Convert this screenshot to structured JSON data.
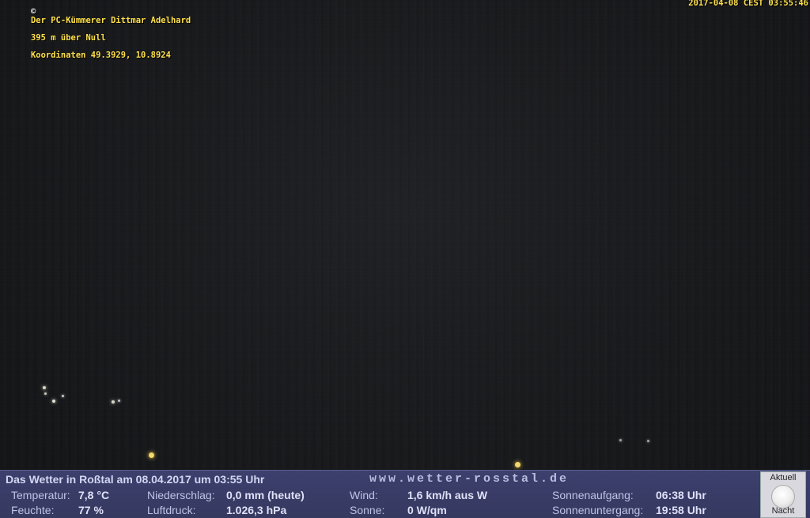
{
  "overlay": {
    "copyright_symbol": "©",
    "owner": "Der PC-Kümmerer Dittmar Adelhard",
    "altitude": "395 m über Null",
    "coordinates": "Koordinaten 49.3929, 10.8924",
    "timestamp": "2017-04-08 CEST 03:55:46"
  },
  "weather": {
    "title": "Das Wetter in Roßtal am 08.04.2017 um 03:55 Uhr",
    "website": "www.wetter-rosstal.de",
    "temperature_label": "Temperatur:",
    "temperature_value": "7,8 °C",
    "humidity_label": "Feuchte:",
    "humidity_value": "77 %",
    "precip_label": "Niederschlag:",
    "precip_value": "0,0 mm (heute)",
    "pressure_label": "Luftdruck:",
    "pressure_value": "1.026,3 hPa",
    "wind_label": "Wind:",
    "wind_value": "1,6 km/h aus W",
    "sun_label": "Sonne:",
    "sun_value": "0 W/qm",
    "sunrise_label": "Sonnenaufgang:",
    "sunrise_value": "06:38 Uhr",
    "sunset_label": "Sonnenuntergang:",
    "sunset_value": "19:58 Uhr"
  },
  "moon": {
    "aktuell_label": "Aktuell",
    "phase_label": "Nacht",
    "icon": "full-moon-icon"
  },
  "colors": {
    "panel_bg": "#3c3f6c",
    "owner_text": "#ffe14a"
  }
}
